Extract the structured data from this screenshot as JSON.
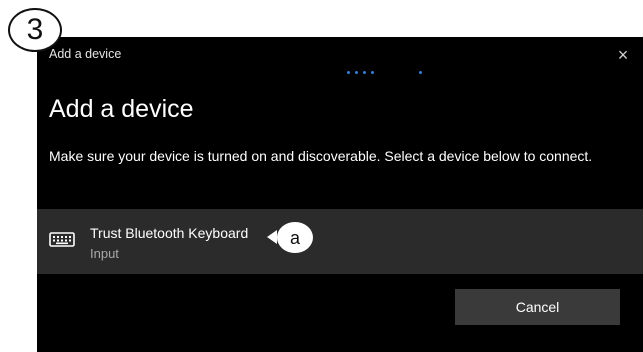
{
  "annotations": {
    "step_number": "3",
    "callout_label": "a"
  },
  "window": {
    "title": "Add a device",
    "close_glyph": "×"
  },
  "dialog": {
    "heading": "Add a device",
    "instructions": "Make sure your device is turned on and discoverable. Select a device below to connect."
  },
  "devices": [
    {
      "name": "Trust Bluetooth Keyboard",
      "type": "Input",
      "icon": "keyboard-icon"
    }
  ],
  "buttons": {
    "cancel_label": "Cancel"
  },
  "colors": {
    "dialog_background": "#000000",
    "device_row_background": "#2b2b2b",
    "cancel_button_background": "#3a3a3a",
    "progress_dots": "#2f7fd6",
    "secondary_text": "#a8a8a8"
  }
}
